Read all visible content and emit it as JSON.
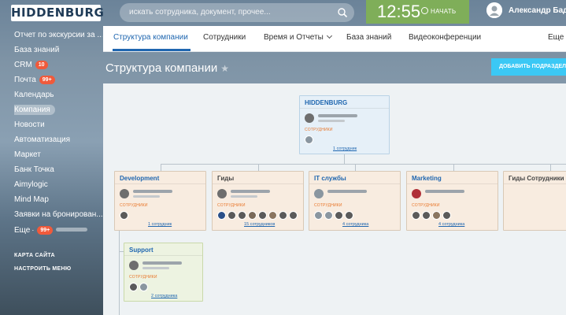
{
  "header": {
    "logo": "HIDDENBURG",
    "search_placeholder": "искать сотрудника, документ, прочее...",
    "time": "12:55",
    "start_label": "НАЧАТЬ",
    "user_name": "Александр Бадилов"
  },
  "sidebar": {
    "items": [
      {
        "label": "Отчет по экскурсии за ...",
        "badge": ""
      },
      {
        "label": "База знаний",
        "badge": ""
      },
      {
        "label": "CRM",
        "badge": "10"
      },
      {
        "label": "Почта",
        "badge": "99+"
      },
      {
        "label": "Календарь",
        "badge": ""
      },
      {
        "label": "Компания",
        "badge": ""
      },
      {
        "label": "Новости",
        "badge": ""
      },
      {
        "label": "Автоматизация",
        "badge": ""
      },
      {
        "label": "Маркет",
        "badge": ""
      },
      {
        "label": "Банк Точка",
        "badge": ""
      },
      {
        "label": "Aimylogic",
        "badge": ""
      },
      {
        "label": "Mind Map",
        "badge": ""
      },
      {
        "label": "Заявки на бронирован...",
        "badge": ""
      },
      {
        "label": "Еще",
        "badge": "99+"
      }
    ],
    "sitemap": "КАРТА САЙТА",
    "configure": "НАСТРОИТЬ МЕНЮ"
  },
  "tabs": [
    {
      "label": "Структура компании"
    },
    {
      "label": "Сотрудники"
    },
    {
      "label": "Время и Отчеты"
    },
    {
      "label": "База знаний"
    },
    {
      "label": "Видеоконференции"
    },
    {
      "label": "Еще"
    }
  ],
  "page": {
    "title": "Структура компании",
    "add_button": "ДОБАВИТЬ ПОДРАЗДЕЛЕНИЕ"
  },
  "structure": {
    "employees_label": "СОТРУДНИКИ",
    "root": {
      "title": "HIDDENBURG",
      "count": "1 сотрудник"
    },
    "departments": [
      {
        "title": "Development",
        "count": "1 сотрудник"
      },
      {
        "title": "Гиды",
        "count": "15 сотрудников"
      },
      {
        "title": "IT службы",
        "count": "4 сотрудника"
      },
      {
        "title": "Marketing",
        "count": "4 сотрудника"
      },
      {
        "title": "Гиды Сотрудники",
        "count": ""
      }
    ],
    "sub": {
      "title": "Support",
      "count": "2 сотрудника"
    }
  },
  "colors": {
    "accent": "#2067b0",
    "timer": "#7fae59",
    "add_button": "#3bc8f5",
    "badge": "#f05a3b",
    "section_label": "#e87528"
  }
}
